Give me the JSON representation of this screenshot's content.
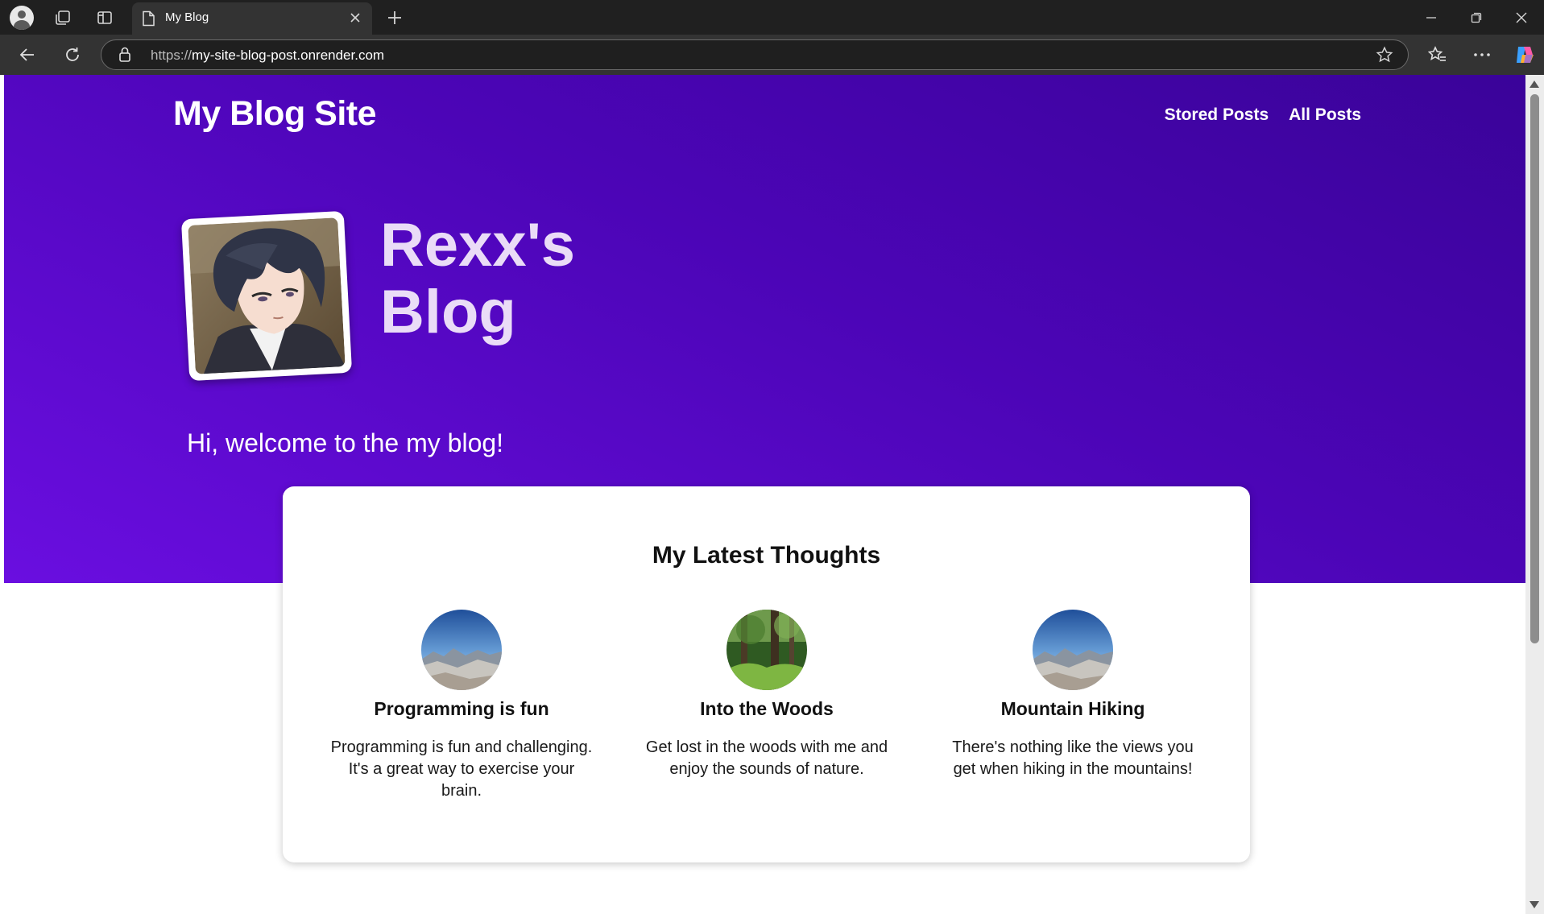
{
  "browser": {
    "tab_title": "My Blog",
    "url_protocol": "https://",
    "url_host": "my-site-blog-post.onrender.com"
  },
  "site": {
    "logo": "My Blog Site",
    "nav": [
      "Stored Posts",
      "All Posts"
    ]
  },
  "hero": {
    "title": "Rexx's Blog",
    "welcome": "Hi, welcome to the my blog!"
  },
  "latest": {
    "heading": "My Latest Thoughts",
    "posts": [
      {
        "title": "Programming is fun",
        "summary": "Programming is fun and challenging. It's a great way to exercise your brain."
      },
      {
        "title": "Into the Woods",
        "summary": "Get lost in the woods with me and enjoy the sounds of nature."
      },
      {
        "title": "Mountain Hiking",
        "summary": "There's nothing like the views you get when hiking in the mountains!"
      }
    ]
  },
  "colors": {
    "hero_gradient_dark": "#3a0399",
    "hero_gradient_light": "#6a0ee0",
    "browser_dark": "#202020"
  },
  "icons": [
    "profile-icon",
    "workspaces-icon",
    "tab-sidebar-icon",
    "page-icon",
    "close-icon",
    "plus-icon",
    "minimize-icon",
    "restore-icon",
    "back-icon",
    "refresh-icon",
    "lock-icon",
    "star-icon",
    "favorites-icon",
    "more-icon",
    "copilot-icon"
  ]
}
